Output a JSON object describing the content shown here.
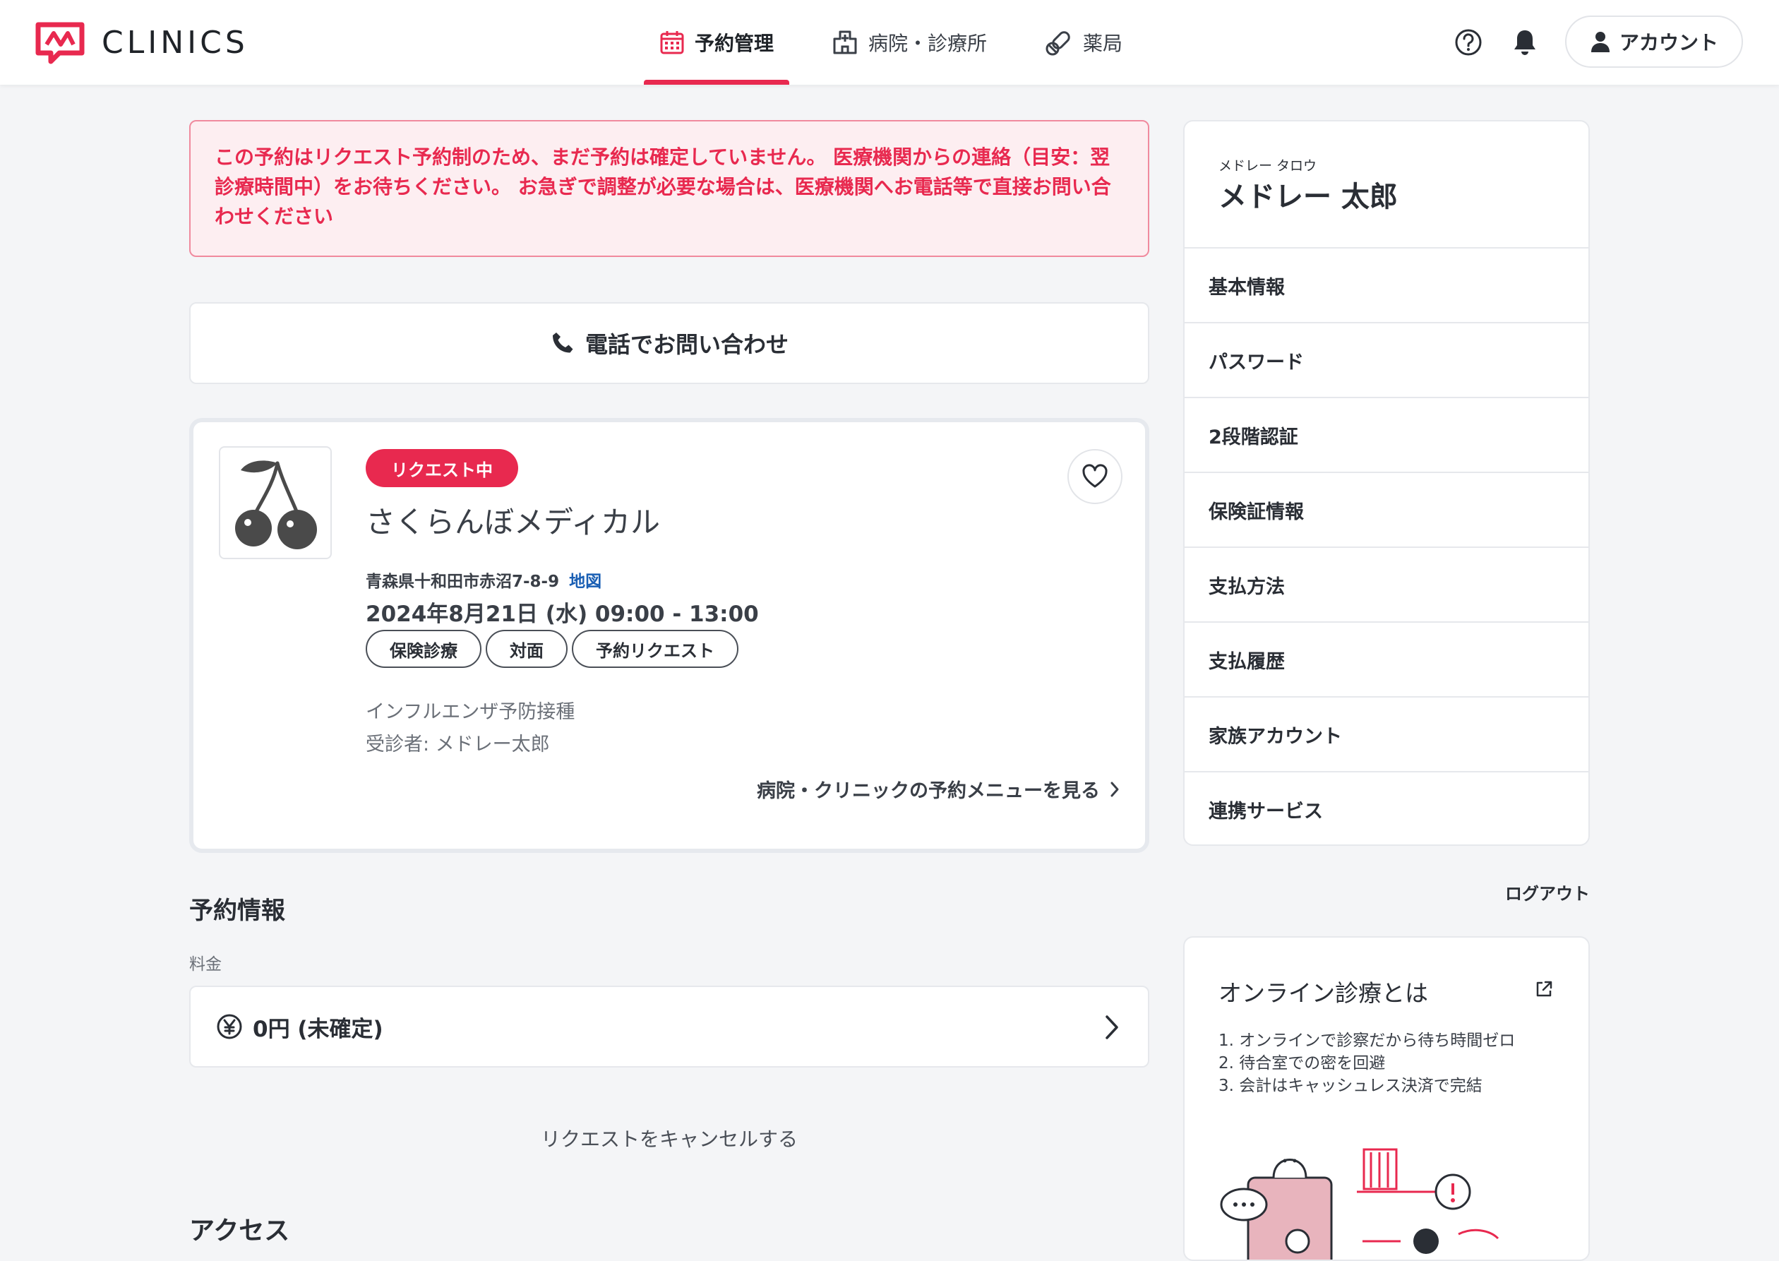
{
  "header": {
    "logo_text": "CLINICS",
    "nav": [
      {
        "label": "予約管理",
        "icon": "calendar-icon",
        "active": true
      },
      {
        "label": "病院・診療所",
        "icon": "hospital-icon",
        "active": false
      },
      {
        "label": "薬局",
        "icon": "pill-icon",
        "active": false
      }
    ],
    "account_label": "アカウント"
  },
  "alert": {
    "text": "この予約はリクエスト予約制のため、まだ予約は確定していません。 医療機関からの連絡（目安：翌診療時間中）をお待ちください。 お急ぎで調整が必要な場合は、医療機関へお電話等で直接お問い合わせください"
  },
  "phone_button": {
    "label": "電話でお問い合わせ"
  },
  "reservation": {
    "status": "リクエスト中",
    "clinic_name": "さくらんぼメディカル",
    "address": "青森県十和田市赤沼7-8-9",
    "map_label": "地図",
    "datetime": "2024年8月21日 (水) 09:00 - 13:00",
    "tags": [
      "保険診療",
      "対面",
      "予約リクエスト"
    ],
    "menu": "インフルエンザ予防接種",
    "patient": "受診者: メドレー太郎",
    "menu_link": "病院・クリニックの予約メニューを見る"
  },
  "booking_info": {
    "title": "予約情報",
    "fee_label": "料金",
    "fee_value": "0円 (未確定)",
    "cancel_label": "リクエストをキャンセルする",
    "access_title": "アクセス"
  },
  "profile": {
    "kana": "メドレー タロウ",
    "name": "メドレー 太郎",
    "menu": [
      "基本情報",
      "パスワード",
      "2段階認証",
      "保険証情報",
      "支払方法",
      "支払履歴",
      "家族アカウント",
      "連携サービス"
    ],
    "logout": "ログアウト"
  },
  "online_info": {
    "title": "オンライン診療とは",
    "items": [
      "1. オンラインで診察だから待ち時間ゼロ",
      "2. 待合室での密を回避",
      "3. 会計はキャッシュレス決済で完結"
    ]
  },
  "colors": {
    "accent": "#e8294f",
    "link": "#1a5fb4",
    "text": "#2a2e35",
    "background": "#f4f5f7"
  }
}
